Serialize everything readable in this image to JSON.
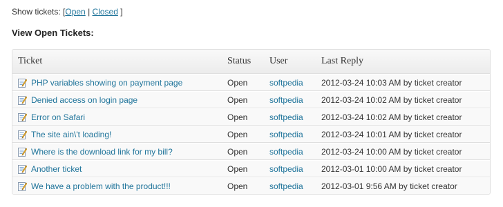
{
  "show_tickets": {
    "label": "Show tickets: [",
    "open_link": "Open",
    "separator": " | ",
    "closed_link": "Closed",
    "close_bracket": " ]"
  },
  "heading": "View Open Tickets:",
  "table": {
    "columns": [
      "Ticket",
      "Status",
      "User",
      "Last Reply"
    ],
    "rows": [
      {
        "ticket": "PHP variables showing on payment page",
        "status": "Open",
        "user": "softpedia",
        "date": "2012-03-24 10:03 AM",
        "by": " by ticket creator"
      },
      {
        "ticket": "Denied access on login page",
        "status": "Open",
        "user": "softpedia",
        "date": "2012-03-24 10:02 AM",
        "by": " by ticket creator"
      },
      {
        "ticket": "Error on Safari",
        "status": "Open",
        "user": "softpedia",
        "date": "2012-03-24 10:02 AM",
        "by": " by ticket creator"
      },
      {
        "ticket": "The site ain\\'t loading!",
        "status": "Open",
        "user": "softpedia",
        "date": "2012-03-24 10:01 AM",
        "by": " by ticket creator"
      },
      {
        "ticket": "Where is the download link for my bill?",
        "status": "Open",
        "user": "softpedia",
        "date": "2012-03-24 10:00 AM",
        "by": " by ticket creator"
      },
      {
        "ticket": "Another ticket",
        "status": "Open",
        "user": "softpedia",
        "date": "2012-03-01 10:00 AM",
        "by": " by ticket creator"
      },
      {
        "ticket": "We have a problem with the product!!!",
        "status": "Open",
        "user": "softpedia",
        "date": "2012-03-01 9:56 AM",
        "by": " by ticket creator"
      }
    ]
  },
  "icons": {
    "ticket_icon": "edit-ticket-icon"
  },
  "colors": {
    "link": "#21759b",
    "header_bg": "#ececec",
    "row_bg": "#f9f9f9",
    "border": "#dfdfdf"
  }
}
